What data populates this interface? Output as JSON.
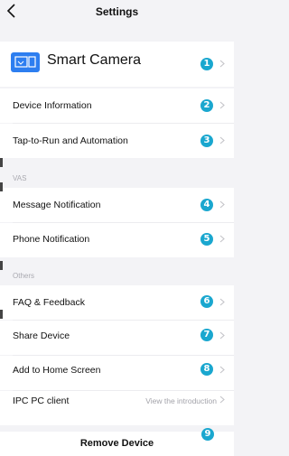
{
  "header": {
    "title": "Settings"
  },
  "device": {
    "name": "Smart Camera",
    "badge": "1"
  },
  "items": [
    {
      "label": "Device Information",
      "badge": "2"
    },
    {
      "label": "Tap-to-Run and Automation",
      "badge": "3"
    }
  ],
  "vas": {
    "section": "VAS",
    "items": [
      {
        "label": "Message Notification",
        "badge": "4"
      },
      {
        "label": "Phone Notification",
        "badge": "5"
      }
    ]
  },
  "others": {
    "section": "Others",
    "items": [
      {
        "label": "FAQ & Feedback",
        "badge": "6"
      },
      {
        "label": "Share Device",
        "badge": "7"
      },
      {
        "label": "Add to Home Screen",
        "badge": "8"
      },
      {
        "label": "IPC PC client",
        "detail": "View the introduction"
      }
    ]
  },
  "remove": {
    "label": "Remove Device",
    "badge": "9"
  },
  "colors": {
    "accent": "#1aa7cf",
    "device_icon": "#2d7ef0"
  }
}
